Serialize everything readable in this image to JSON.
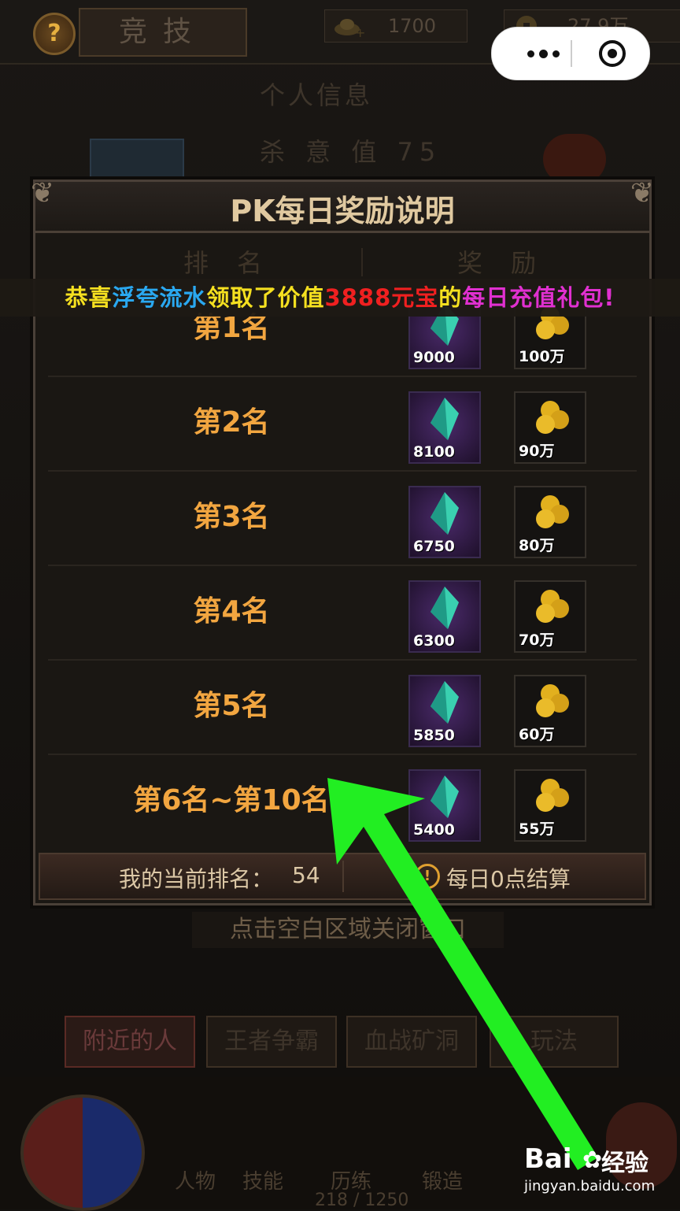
{
  "topbar": {
    "help_symbol": "?",
    "title": "竞技",
    "gold": "1700",
    "coins": "27.9万"
  },
  "background": {
    "info_title": "个人信息",
    "kill_value": "杀 意 值 75"
  },
  "dialog": {
    "title": "PK每日奖励说明",
    "col_rank": "排名",
    "col_reward": "奖励",
    "rows": [
      {
        "rank": "第1名",
        "gems": "9000",
        "coins": "100万"
      },
      {
        "rank": "第2名",
        "gems": "8100",
        "coins": "90万"
      },
      {
        "rank": "第3名",
        "gems": "6750",
        "coins": "80万"
      },
      {
        "rank": "第4名",
        "gems": "6300",
        "coins": "70万"
      },
      {
        "rank": "第5名",
        "gems": "5850",
        "coins": "60万"
      },
      {
        "rank": "第6名~第10名",
        "gems": "5400",
        "coins": "55万"
      }
    ],
    "my_rank_label": "我的当前排名：",
    "my_rank_value": "54",
    "settle_note": "每日0点结算",
    "close_hint": "点击空白区域关闭窗口"
  },
  "broadcast": {
    "part1": "恭喜",
    "player": "浮夸流水",
    "part2": "领取了价值",
    "amount": "3888元宝",
    "part3": "的",
    "package": "每日充值礼包!"
  },
  "bottom_tabs": [
    "附近的人",
    "王者争霸",
    "血战矿洞",
    "玩法"
  ],
  "bottom_nav": [
    "人物",
    "技能",
    "历练",
    "锻造"
  ],
  "progress": "218 / 1250",
  "watermark": {
    "brand": "Bai",
    "brand2": "经验",
    "url": "jingyan.baidu.com"
  },
  "colors": {
    "accent_orange": "#f2a640",
    "arrow_green": "#22ee22",
    "highlight_red": "#f02020",
    "player_blue": "#2aa8f0",
    "package_pink": "#e030d0"
  }
}
